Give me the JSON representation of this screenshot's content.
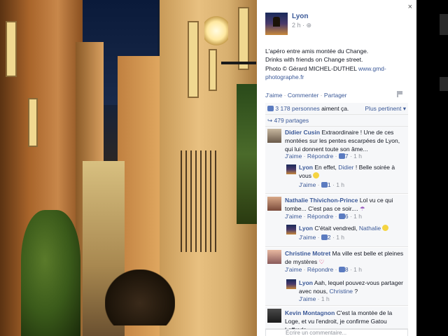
{
  "post": {
    "page_name": "Lyon",
    "time": "2 h ·",
    "text_line1": "L'apéro entre amis montée du Change.",
    "text_line2": "Drinks with friends on Change street.",
    "photo_credit": "Photo © Gérard MICHEL-DUTHEL",
    "photo_link": "www.gmd-photographe.fr",
    "close_label": "×"
  },
  "actions": {
    "like": "J'aime",
    "comment": "Commenter",
    "share": "Partager",
    "sep": "·"
  },
  "stats": {
    "likes_count": "3 178 personnes",
    "likes_suffix": "aiment ça.",
    "sort_label": "Plus pertinent ▾",
    "shares": "479 partages"
  },
  "comments": [
    {
      "name": "Didier Cusin",
      "text": "Extraordinaire ! Une de ces montées sur les pentes escarpées de Lyon, qui lui donnent toute son âme...",
      "like": "J'aime",
      "reply": "Répondre",
      "count": "7",
      "time": "1 h",
      "reply_item": {
        "name": "Lyon",
        "text_before": "En effet,",
        "mention": "Didier",
        "text_after": "! Belle soirée à vous",
        "like": "J'aime",
        "count": "1",
        "time": "1 h"
      }
    },
    {
      "name": "Nathalie Thivichon-Prince",
      "text": "Lol vu ce qui tombe... C'est pas ce soir....",
      "like": "J'aime",
      "reply": "Répondre",
      "count": "6",
      "time": "1 h",
      "reply_item": {
        "name": "Lyon",
        "text_before": "C'était vendredi,",
        "mention": "Nathalie",
        "text_after": "",
        "like": "J'aime",
        "count": "2",
        "time": "1 h"
      }
    },
    {
      "name": "Christine Motret",
      "text": "Ma ville est belle et pleines de mystères",
      "like": "J'aime",
      "reply": "Répondre",
      "count": "8",
      "time": "1 h",
      "reply_item": {
        "name": "Lyon",
        "text_before": "Aah, lequel pouvez-vous partager avec nous,",
        "mention": "Christine",
        "text_after": "?",
        "like": "J'aime",
        "count": "",
        "time": "1 h"
      }
    },
    {
      "name": "Kevin Montagnon",
      "text": "C'est la montée de la Loge, et vu l'endroit, je confirme Gatou Loffreda..."
    }
  ],
  "comment_input": {
    "placeholder": "Écrire un commentaire..."
  },
  "colors": {
    "link": "#3b5998",
    "meta": "#90949c",
    "panel_bg": "#f6f7f9"
  }
}
